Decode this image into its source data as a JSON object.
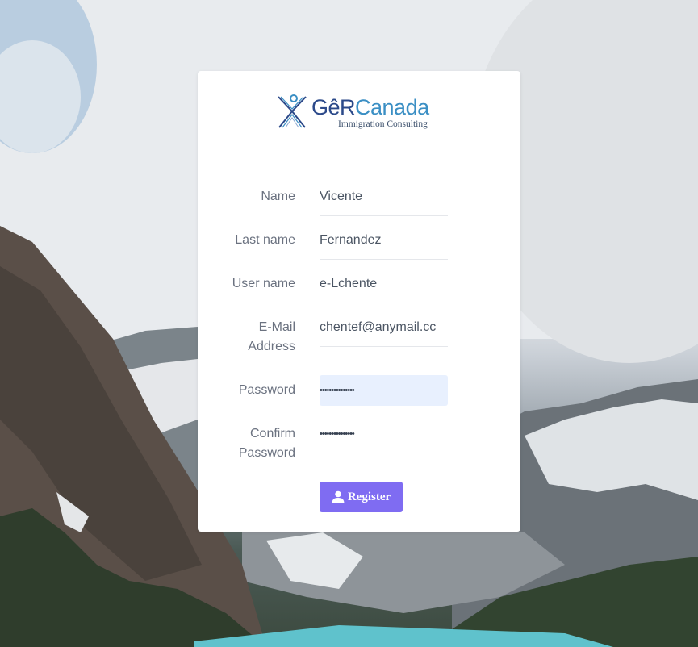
{
  "logo": {
    "brand_part1": "GêR",
    "brand_part2": "Canada",
    "subtitle": "Immigration Consulting"
  },
  "form": {
    "fields": [
      {
        "label": "Name",
        "value": "Vicente"
      },
      {
        "label": "Last name",
        "value": "Fernandez"
      },
      {
        "label": "User name",
        "value": "e-Lchente"
      },
      {
        "label": "E-Mail Address",
        "value": "chentef@anymail.cc"
      },
      {
        "label": "Password",
        "value": "•••••••••••••••"
      },
      {
        "label": "Confirm Password",
        "value": "•••••••••••••••"
      }
    ],
    "register_label": "Register",
    "register_icon": "user-icon"
  },
  "colors": {
    "button": "#7f6cf2",
    "brand_light": "#3b8fc4",
    "brand_dark": "#2c4a8a",
    "autofill": "#e8f0fe"
  }
}
